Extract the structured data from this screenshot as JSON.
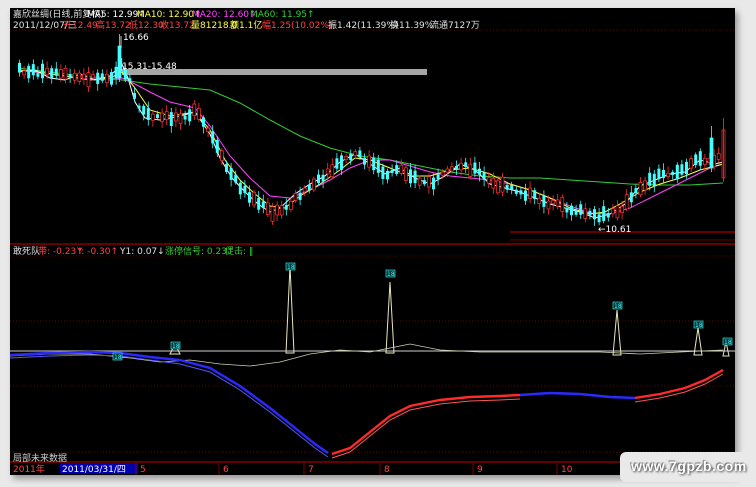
{
  "header": {
    "security_title": "嘉欣丝绸(日线,前复权)",
    "ma5": "MA5: 12.99↑",
    "ma10": "MA10: 12.90↑",
    "ma20": "MA20: 12.60↑",
    "ma60": "MA60: 11.95↑"
  },
  "info_line": {
    "date": "2011/12/07/三",
    "open": "开12.49",
    "high": "高13.72",
    "low": "低12.30",
    "close": "收13.72",
    "volume": "量81218.0",
    "amount": "额1.1亿",
    "change_pct": "幅1.25(10.02%)",
    "swing": "振1.42(11.39%)",
    "turnover": "换11.39%",
    "float": "流通7127万"
  },
  "price_annotations": {
    "high_label": "16.66",
    "range_label": "15.31-15.48",
    "low_label": "←10.61"
  },
  "indicator_header": {
    "name": "敢死队",
    "item_a": "带: -0.23↑",
    "item_b": "Y: -0.30↑",
    "item_c": "Y1: 0.07↓",
    "item_d": "涨停信号: 0.23↑",
    "item_e": "促击: ‖"
  },
  "markers": [
    "18",
    "18",
    "18",
    "18",
    "18",
    "18",
    "18"
  ],
  "bottom_label": "局部未来数据",
  "timeline": {
    "year_tab": "2011年",
    "current_date": "2011/03/31/四",
    "months": [
      "5",
      "6",
      "7",
      "8",
      "9",
      "10",
      "11"
    ]
  },
  "watermark": "www.7gpzb.com",
  "colors": {
    "background": "#000000",
    "up": "#ff3333",
    "down": "#44ffff",
    "ma5": "#ffffff",
    "ma10": "#ffff44",
    "ma20": "#ff44ff",
    "ma60": "#33cc33",
    "grid": "#cc0000"
  }
}
